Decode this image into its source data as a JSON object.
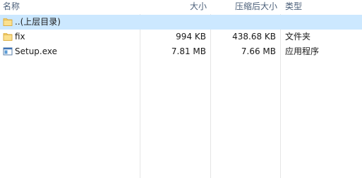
{
  "columns": {
    "name": "名称",
    "size": "大小",
    "packed": "压缩后大小",
    "type": "类型"
  },
  "rows": [
    {
      "name": "..(上层目录)",
      "size": "",
      "packed": "",
      "type": "",
      "icon": "folder-icon",
      "selected": true
    },
    {
      "name": "fix",
      "size": "994 KB",
      "packed": "438.68 KB",
      "type": "文件夹",
      "icon": "folder-icon",
      "selected": false
    },
    {
      "name": "Setup.exe",
      "size": "7.81 MB",
      "packed": "7.66 MB",
      "type": "应用程序",
      "icon": "application-icon",
      "selected": false
    }
  ],
  "colors": {
    "selected_row": "#cce8ff",
    "folder": "#f8d775",
    "header_text": "#4c607a"
  }
}
